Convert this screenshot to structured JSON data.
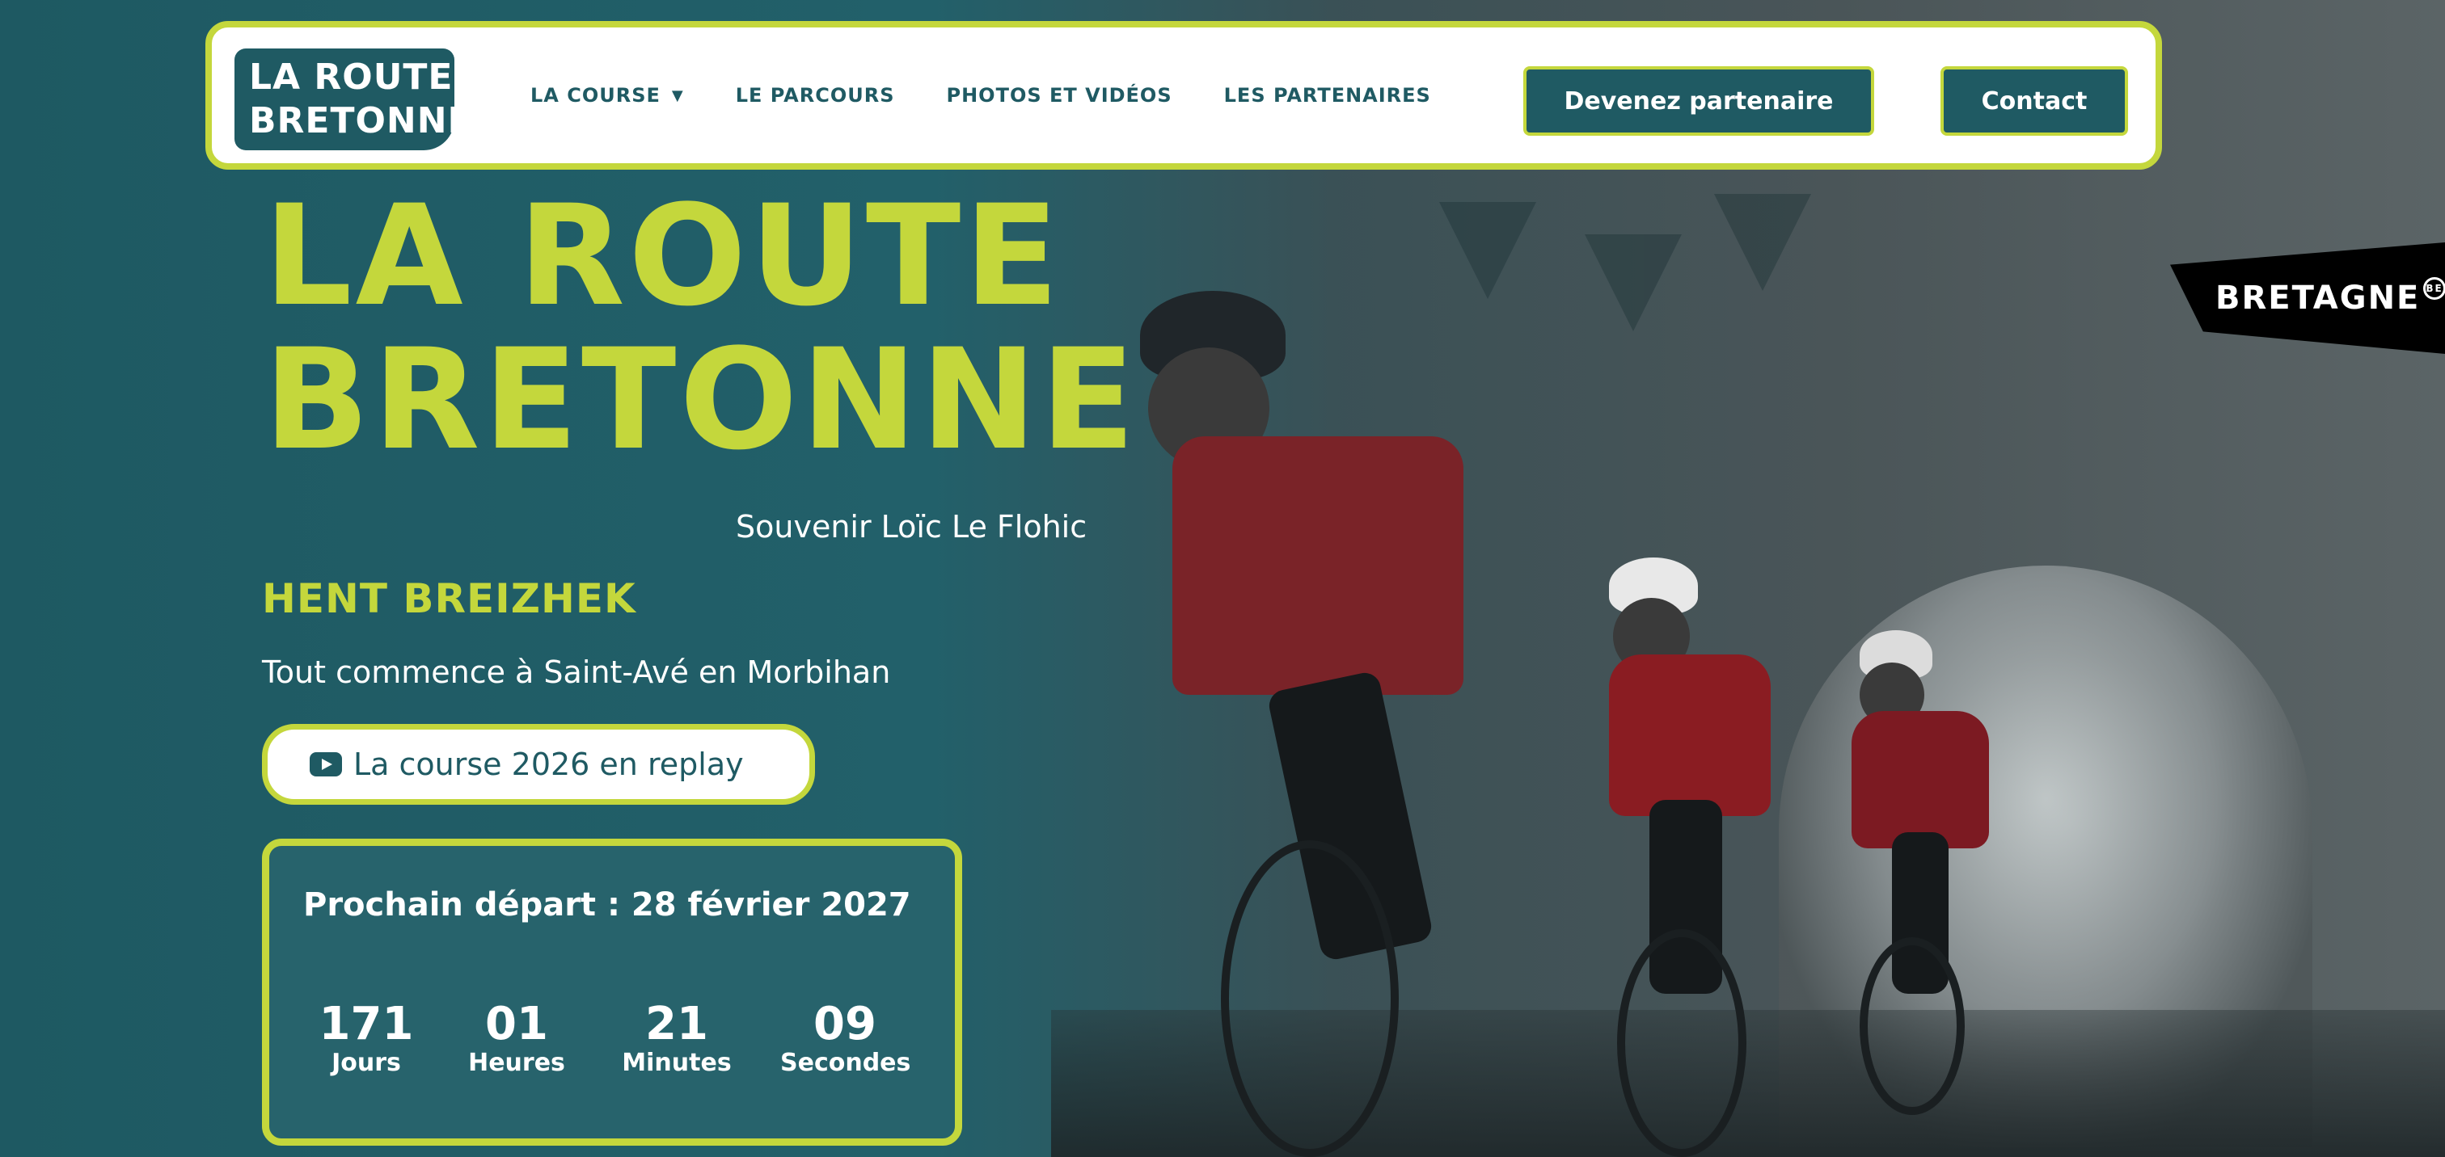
{
  "header": {
    "logo_line1": "LA ROUTE",
    "logo_line2": "BRETONNE",
    "nav": [
      {
        "label": "LA COURSE",
        "has_dropdown": true
      },
      {
        "label": "LE PARCOURS"
      },
      {
        "label": "PHOTOS ET VIDÉOS"
      },
      {
        "label": "LES PARTENAIRES"
      }
    ],
    "partner_button": "Devenez partenaire",
    "contact_button": "Contact"
  },
  "hero": {
    "title_line1": "LA ROUTE",
    "title_line2": "BRETONNE",
    "subtitle": "Souvenir Loïc Le Flohic",
    "breton_name": "HENT BREIZHEK",
    "tagline": "Tout commence à Saint-Avé en Morbihan",
    "replay_button": "La course 2026 en replay",
    "replay_icon": "youtube-play-icon"
  },
  "countdown": {
    "title": "Prochain départ : 28 février 2027",
    "units": [
      {
        "value": "171",
        "label": "Jours"
      },
      {
        "value": "01",
        "label": "Heures"
      },
      {
        "value": "21",
        "label": "Minutes"
      },
      {
        "value": "09",
        "label": "Secondes"
      }
    ]
  },
  "badge": {
    "text": "BRETAGNE",
    "mark": "BE"
  },
  "colors": {
    "primary": "#1f5a63",
    "accent": "#c4d73c",
    "white": "#ffffff"
  }
}
